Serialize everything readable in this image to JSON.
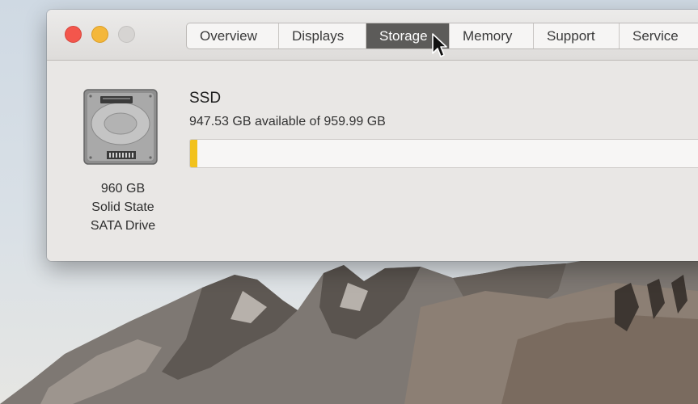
{
  "window": {
    "tabs": [
      {
        "label": "Overview",
        "active": false
      },
      {
        "label": "Displays",
        "active": false
      },
      {
        "label": "Storage",
        "active": true
      },
      {
        "label": "Memory",
        "active": false
      },
      {
        "label": "Support",
        "active": false
      },
      {
        "label": "Service",
        "active": false
      }
    ]
  },
  "storage": {
    "drive_name": "SSD",
    "availability": "947.53 GB available of 959.99 GB",
    "used_fraction": 0.013,
    "bar_color": "#f2c21c",
    "caption": [
      "960 GB",
      "Solid State",
      "SATA Drive"
    ]
  },
  "colors": {
    "close": "#f3564c",
    "minimize": "#f4b73a",
    "zoom": "#d6d4d2",
    "active_tab": "#5c5b59"
  },
  "icons": {
    "drive": "hard-drive-icon",
    "cursor": "pointer-cursor-icon"
  }
}
